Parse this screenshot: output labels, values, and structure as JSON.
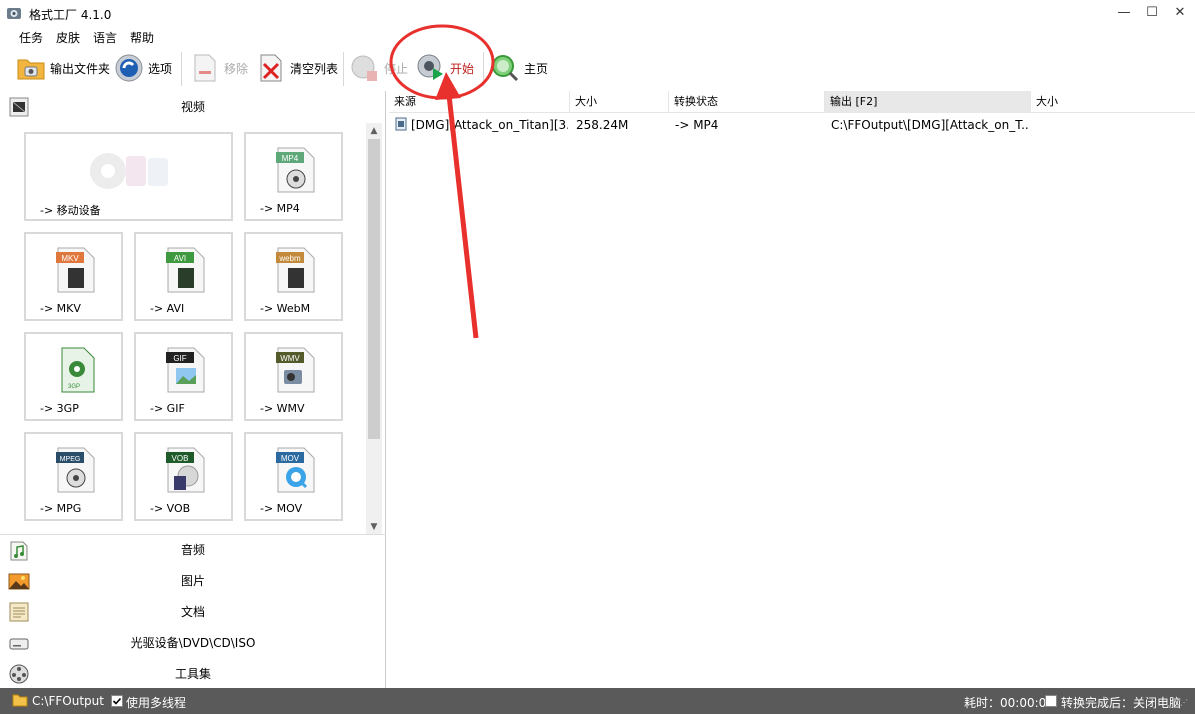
{
  "window": {
    "title": "格式工厂 4.1.0",
    "controls": {
      "minimize": "—",
      "maximize": "☐",
      "close": "✕"
    }
  },
  "menu": [
    "任务",
    "皮肤",
    "语言",
    "帮助"
  ],
  "toolbar": {
    "output_folder": "输出文件夹",
    "options": "选项",
    "remove": "移除",
    "clear_list": "清空列表",
    "stop": "停止",
    "start": "开始",
    "home": "主页"
  },
  "left": {
    "video_header": "视频",
    "tiles": [
      {
        "label": "-> 移动设备",
        "badge": "",
        "icon": "mobile-device-icon"
      },
      {
        "label": "-> MP4",
        "badge": "MP4",
        "icon": "mp4-file-icon"
      },
      {
        "label": "-> MKV",
        "badge": "MKV",
        "icon": "mkv-file-icon"
      },
      {
        "label": "-> AVI",
        "badge": "AVI",
        "icon": "avi-file-icon"
      },
      {
        "label": "-> WebM",
        "badge": "webm",
        "icon": "webm-file-icon"
      },
      {
        "label": "-> 3GP",
        "badge": "3GP",
        "icon": "3gp-file-icon"
      },
      {
        "label": "-> GIF",
        "badge": "GIF",
        "icon": "gif-file-icon"
      },
      {
        "label": "-> WMV",
        "badge": "WMV",
        "icon": "wmv-file-icon"
      },
      {
        "label": "-> MPG",
        "badge": "MPEG",
        "icon": "mpeg-file-icon"
      },
      {
        "label": "-> VOB",
        "badge": "VOB",
        "icon": "vob-file-icon"
      },
      {
        "label": "-> MOV",
        "badge": "MOV",
        "icon": "mov-file-icon"
      }
    ],
    "categories": [
      "音频",
      "图片",
      "文档",
      "光驱设备\\DVD\\CD\\ISO",
      "工具集"
    ]
  },
  "table": {
    "headers": [
      "来源",
      "大小",
      "转换状态",
      "输出 [F2]",
      "大小"
    ],
    "rows": [
      {
        "source": "[DMG][Attack_on_Titan][3...",
        "size": "258.24M",
        "status": "-> MP4",
        "output": "C:\\FFOutput\\[DMG][Attack_on_T...",
        "out_size": ""
      }
    ]
  },
  "status": {
    "output_path": "C:\\FFOutput",
    "multithread": "使用多线程",
    "multithread_checked": true,
    "elapsed": "耗时：00:00:00",
    "after_convert": "转换完成后：关闭电脑",
    "after_convert_checked": false
  },
  "colors": {
    "accent_red": "#e8302d",
    "statusbar": "#5a5a5a",
    "header_active": "#e8e8e8"
  }
}
